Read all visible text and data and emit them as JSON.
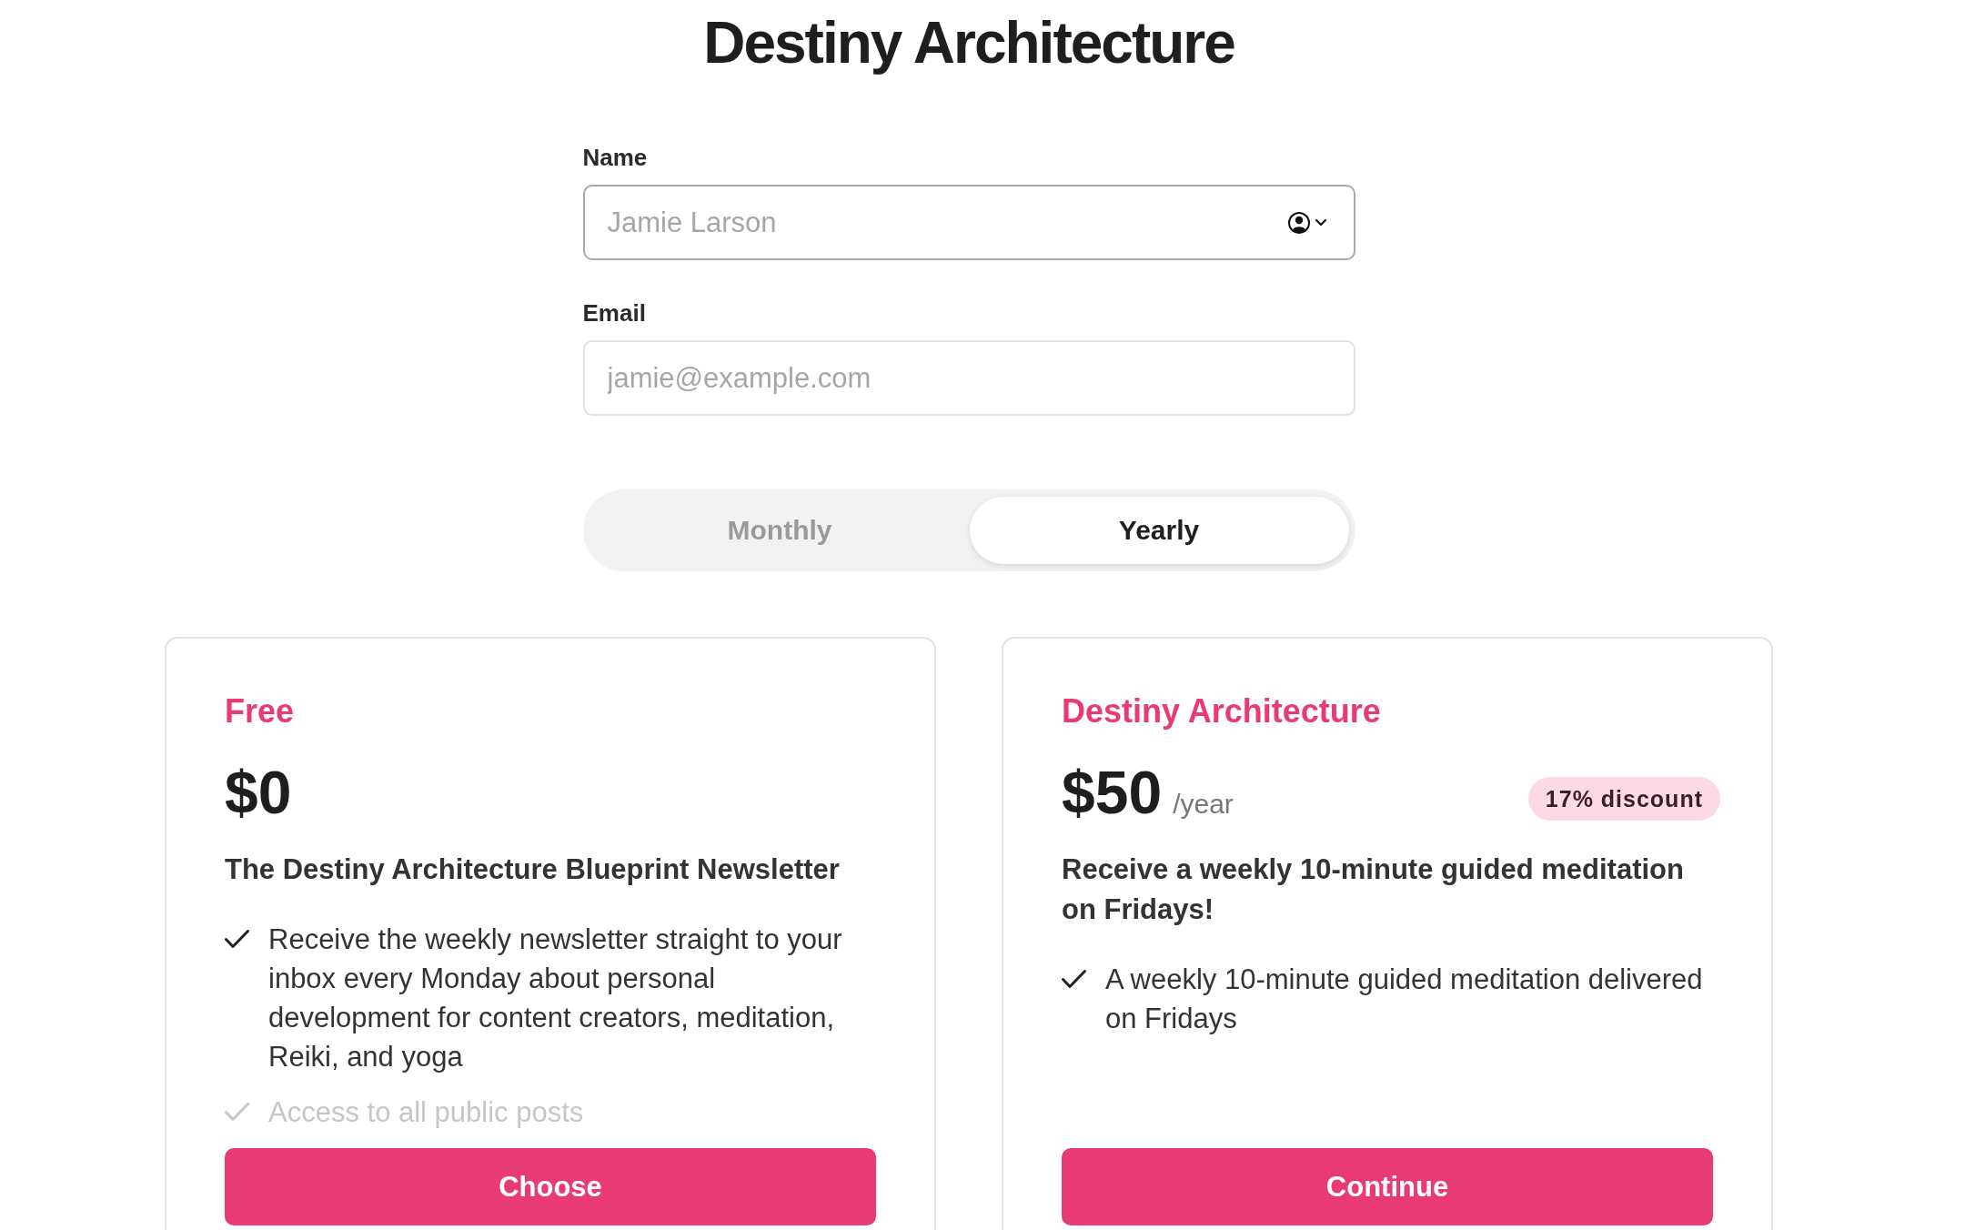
{
  "title": "Destiny Architecture",
  "form": {
    "fields": [
      {
        "label": "Name",
        "placeholder": "Jamie Larson",
        "kind": "contact",
        "focused": true
      },
      {
        "label": "Email",
        "placeholder": "jamie@example.com",
        "kind": "plain",
        "focused": false
      }
    ]
  },
  "billing_toggle": {
    "options": [
      {
        "label": "Monthly",
        "selected": false
      },
      {
        "label": "Yearly",
        "selected": true
      }
    ]
  },
  "plans": [
    {
      "name": "Free",
      "price": "$0",
      "heading": "The Destiny Architecture Blueprint Newsletter",
      "features": [
        {
          "text": "Receive the weekly newsletter straight to your inbox every Monday about personal development for content creators, meditation, Reiki, and yoga",
          "dimmed": false
        },
        {
          "text": "Access to all public posts",
          "dimmed": true
        }
      ],
      "button": "Choose"
    },
    {
      "name": "Destiny Architecture",
      "price": "$50",
      "period": "/year",
      "badge": "17% discount",
      "heading": "Receive a weekly 10-minute guided meditation on Fridays!",
      "features": [
        {
          "text": "A weekly 10-minute guided meditation delivered on Fridays",
          "dimmed": false
        }
      ],
      "button": "Continue"
    }
  ]
}
